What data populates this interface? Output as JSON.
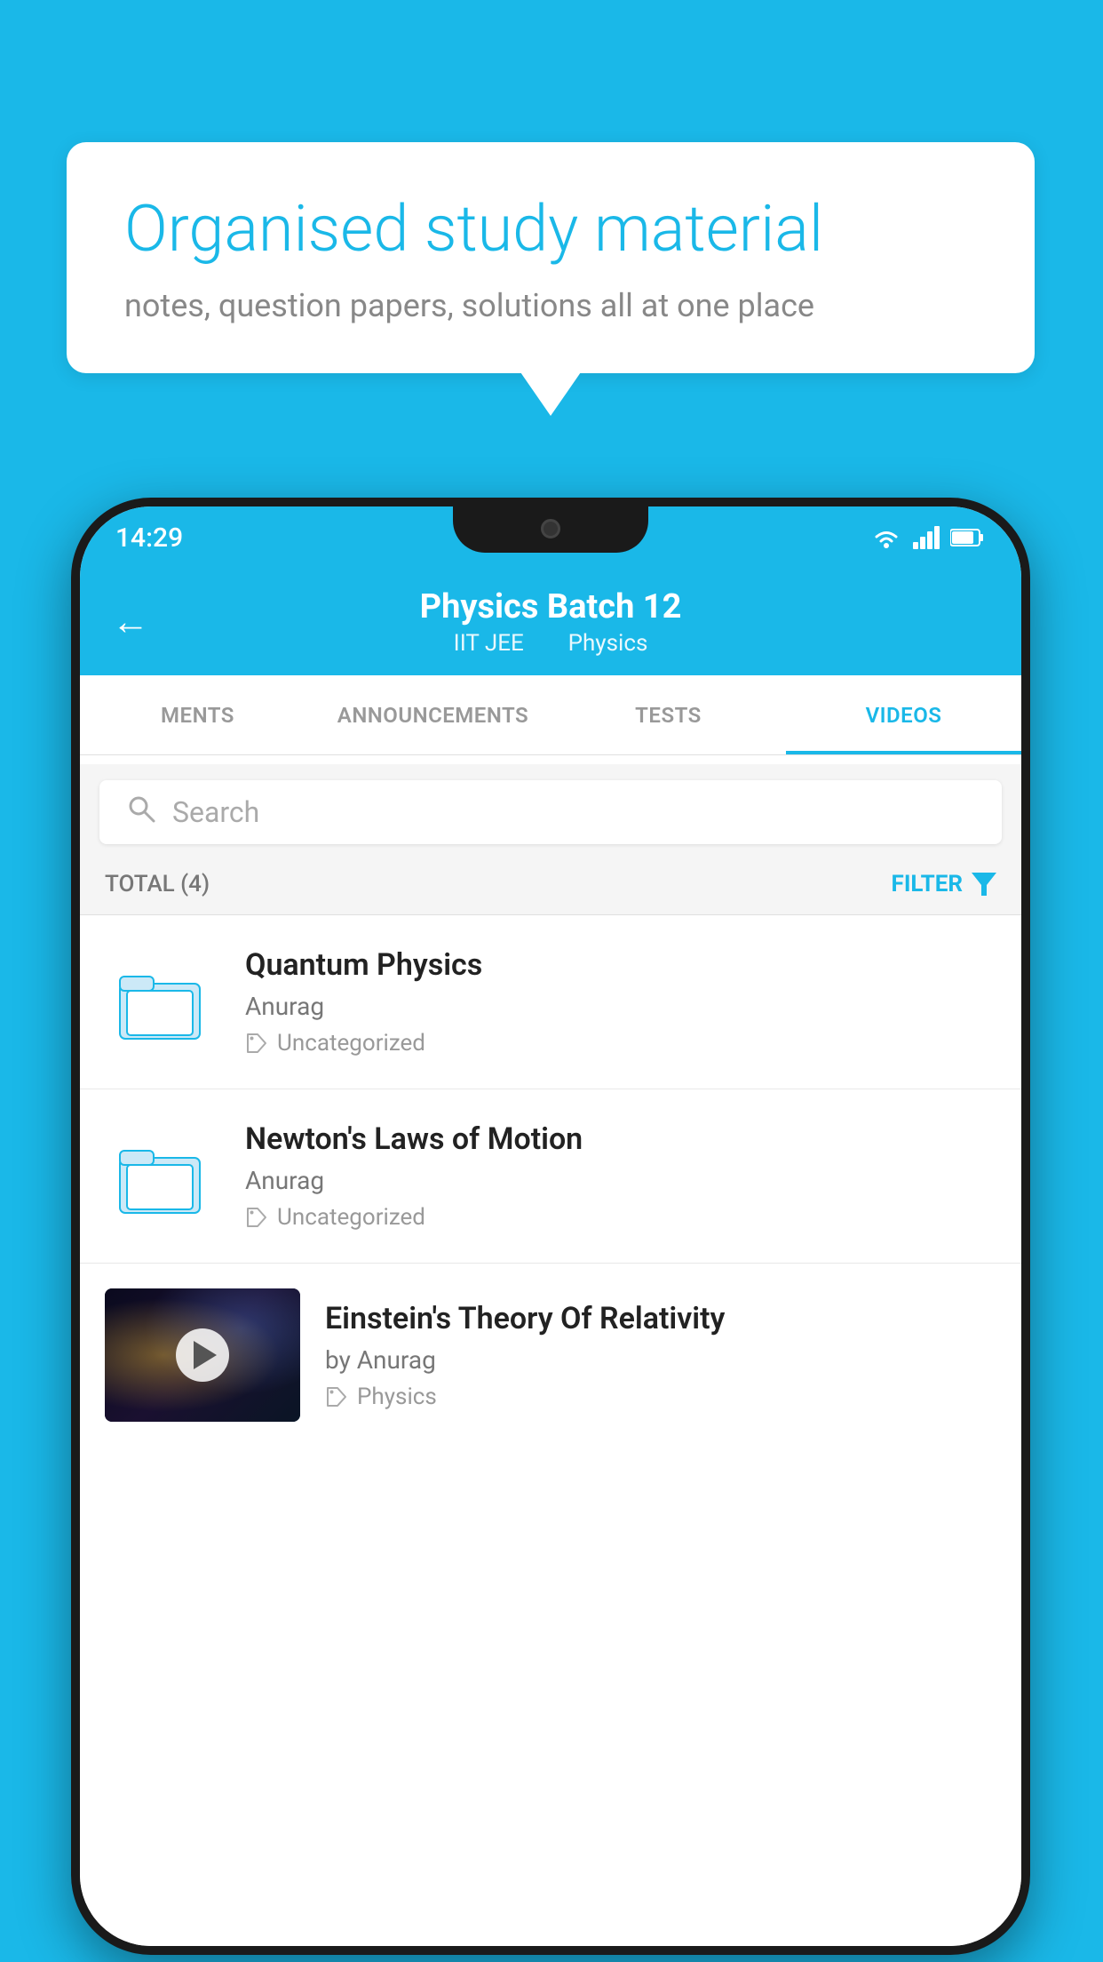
{
  "background_color": "#1ab8e8",
  "bubble": {
    "title": "Organised study material",
    "subtitle": "notes, question papers, solutions all at one place"
  },
  "status_bar": {
    "time": "14:29"
  },
  "app_header": {
    "title": "Physics Batch 12",
    "subtitle_part1": "IIT JEE",
    "subtitle_part2": "Physics",
    "back_label": "←"
  },
  "tabs": [
    {
      "label": "MENTS",
      "active": false
    },
    {
      "label": "ANNOUNCEMENTS",
      "active": false
    },
    {
      "label": "TESTS",
      "active": false
    },
    {
      "label": "VIDEOS",
      "active": true
    }
  ],
  "search": {
    "placeholder": "Search"
  },
  "filter_bar": {
    "total_label": "TOTAL (4)",
    "filter_label": "FILTER"
  },
  "videos": [
    {
      "title": "Quantum Physics",
      "author": "Anurag",
      "tag": "Uncategorized",
      "type": "folder"
    },
    {
      "title": "Newton's Laws of Motion",
      "author": "Anurag",
      "tag": "Uncategorized",
      "type": "folder"
    },
    {
      "title": "Einstein's Theory Of Relativity",
      "author": "by Anurag",
      "tag": "Physics",
      "type": "video"
    }
  ]
}
